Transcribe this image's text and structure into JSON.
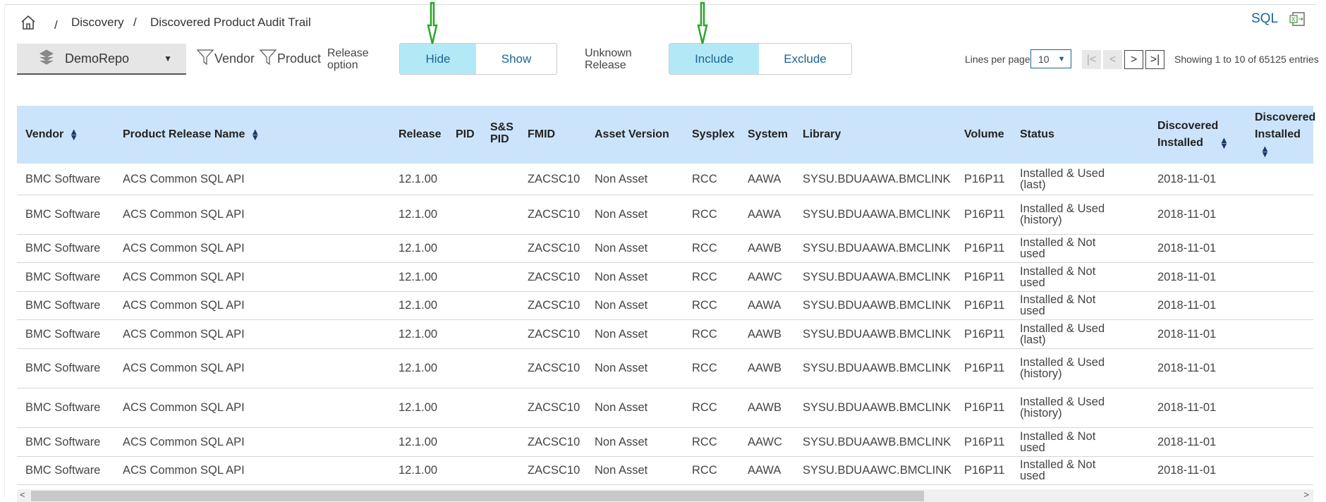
{
  "breadcrumb": {
    "home_icon": "home-icon",
    "items": [
      "Discovery",
      "Discovered Product Audit Trail"
    ],
    "sep": "/"
  },
  "header": {
    "sql_label": "SQL",
    "excel_icon": "excel-export-icon"
  },
  "toolbar": {
    "repo": "DemoRepo",
    "vendor_filter": "Vendor",
    "product_filter": "Product",
    "release_option_label": [
      "Release",
      "option"
    ],
    "release_option": {
      "options": [
        "Hide",
        "Show"
      ],
      "selected": "Hide"
    },
    "unknown_release_label": [
      "Unknown",
      "Release"
    ],
    "unknown_release": {
      "options": [
        "Include",
        "Exclude"
      ],
      "selected": "Include"
    },
    "lines_per_page_label": "Lines per page",
    "lines_per_page": "10",
    "showing": "Showing 1 to 10 of 65125 entries"
  },
  "table": {
    "columns": [
      "Vendor",
      "Product Release Name",
      "Release",
      "PID",
      "S&S PID",
      "FMID",
      "Asset Version",
      "Sysplex",
      "System",
      "Library",
      "Volume",
      "Status",
      "Discovered Installed",
      "Discovered Installed"
    ],
    "rows": [
      [
        "BMC Software",
        "ACS Common SQL API",
        "12.1.00",
        "",
        "",
        "ZACSC10",
        "Non Asset",
        "RCC",
        "AAWA",
        "SYSU.BDUAAWA.BMCLINK",
        "P16P11",
        "Installed & Used (last)",
        "2018-11-01",
        ""
      ],
      [
        "BMC Software",
        "ACS Common SQL API",
        "12.1.00",
        "",
        "",
        "ZACSC10",
        "Non Asset",
        "RCC",
        "AAWA",
        "SYSU.BDUAAWA.BMCLINK",
        "P16P11",
        "Installed & Used (history)",
        "2018-11-01",
        ""
      ],
      [
        "BMC Software",
        "ACS Common SQL API",
        "12.1.00",
        "",
        "",
        "ZACSC10",
        "Non Asset",
        "RCC",
        "AAWB",
        "SYSU.BDUAAWA.BMCLINK",
        "P16P11",
        "Installed & Not used",
        "2018-11-01",
        ""
      ],
      [
        "BMC Software",
        "ACS Common SQL API",
        "12.1.00",
        "",
        "",
        "ZACSC10",
        "Non Asset",
        "RCC",
        "AAWC",
        "SYSU.BDUAAWA.BMCLINK",
        "P16P11",
        "Installed & Not used",
        "2018-11-01",
        ""
      ],
      [
        "BMC Software",
        "ACS Common SQL API",
        "12.1.00",
        "",
        "",
        "ZACSC10",
        "Non Asset",
        "RCC",
        "AAWA",
        "SYSU.BDUAAWB.BMCLINK",
        "P16P11",
        "Installed & Not used",
        "2018-11-01",
        ""
      ],
      [
        "BMC Software",
        "ACS Common SQL API",
        "12.1.00",
        "",
        "",
        "ZACSC10",
        "Non Asset",
        "RCC",
        "AAWB",
        "SYSU.BDUAAWB.BMCLINK",
        "P16P11",
        "Installed & Used (last)",
        "2018-11-01",
        ""
      ],
      [
        "BMC Software",
        "ACS Common SQL API",
        "12.1.00",
        "",
        "",
        "ZACSC10",
        "Non Asset",
        "RCC",
        "AAWB",
        "SYSU.BDUAAWB.BMCLINK",
        "P16P11",
        "Installed & Used (history)",
        "2018-11-01",
        ""
      ],
      [
        "BMC Software",
        "ACS Common SQL API",
        "12.1.00",
        "",
        "",
        "ZACSC10",
        "Non Asset",
        "RCC",
        "AAWB",
        "SYSU.BDUAAWB.BMCLINK",
        "P16P11",
        "Installed & Used (history)",
        "2018-11-01",
        ""
      ],
      [
        "BMC Software",
        "ACS Common SQL API",
        "12.1.00",
        "",
        "",
        "ZACSC10",
        "Non Asset",
        "RCC",
        "AAWC",
        "SYSU.BDUAAWB.BMCLINK",
        "P16P11",
        "Installed & Not used",
        "2018-11-01",
        ""
      ],
      [
        "BMC Software",
        "ACS Common SQL API",
        "12.1.00",
        "",
        "",
        "ZACSC10",
        "Non Asset",
        "RCC",
        "AAWA",
        "SYSU.BDUAAWC.BMCLINK",
        "P16P11",
        "Installed & Not used",
        "2018-11-01",
        ""
      ]
    ]
  },
  "colors": {
    "header_bg": "#cce4fb",
    "selected_bg": "#b3e9f7",
    "link": "#1a6496",
    "annotation_arrow": "#2aa52a"
  }
}
